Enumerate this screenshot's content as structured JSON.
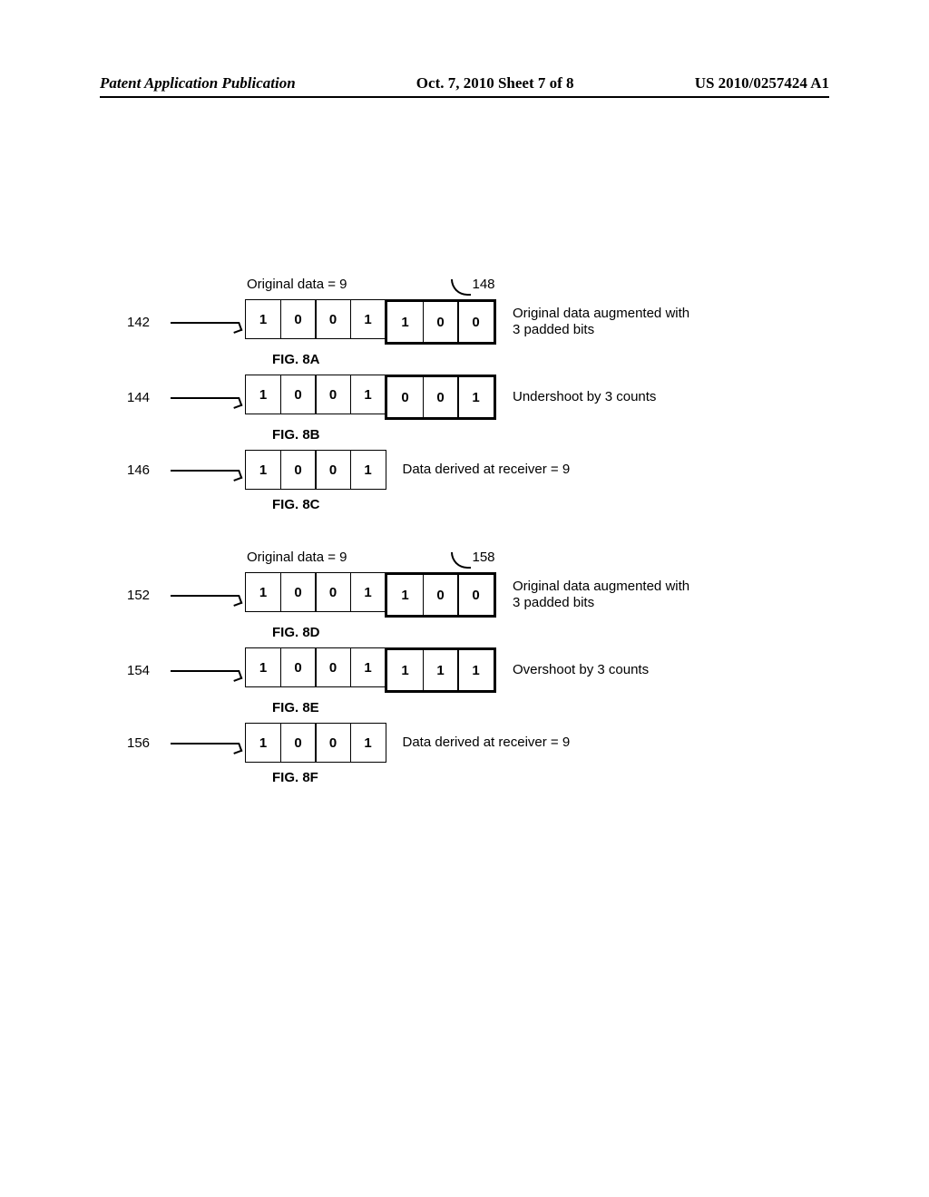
{
  "header": {
    "left": "Patent Application Publication",
    "center": "Oct. 7, 2010   Sheet 7 of 8",
    "right": "US 2010/0257424 A1"
  },
  "group1": {
    "top_label": "Original data = 9",
    "callout_ref": "148",
    "fig_a": {
      "ref": "142",
      "bits_main": [
        "1",
        "0",
        "0",
        "1"
      ],
      "bits_pad": [
        "1",
        "0",
        "0"
      ],
      "desc": "Original data augmented with 3 padded bits",
      "label": "FIG. 8A"
    },
    "fig_b": {
      "ref": "144",
      "bits_main": [
        "1",
        "0",
        "0",
        "1"
      ],
      "bits_pad": [
        "0",
        "0",
        "1"
      ],
      "desc": "Undershoot by 3 counts",
      "label": "FIG. 8B"
    },
    "fig_c": {
      "ref": "146",
      "bits_main": [
        "1",
        "0",
        "0",
        "1"
      ],
      "desc": "Data derived at receiver = 9",
      "label": "FIG. 8C"
    }
  },
  "group2": {
    "top_label": "Original data = 9",
    "callout_ref": "158",
    "fig_d": {
      "ref": "152",
      "bits_main": [
        "1",
        "0",
        "0",
        "1"
      ],
      "bits_pad": [
        "1",
        "0",
        "0"
      ],
      "desc": "Original data augmented with 3 padded bits",
      "label": "FIG. 8D"
    },
    "fig_e": {
      "ref": "154",
      "bits_main": [
        "1",
        "0",
        "0",
        "1"
      ],
      "bits_pad": [
        "1",
        "1",
        "1"
      ],
      "desc": "Overshoot by 3 counts",
      "label": "FIG. 8E"
    },
    "fig_f": {
      "ref": "156",
      "bits_main": [
        "1",
        "0",
        "0",
        "1"
      ],
      "desc": "Data derived at receiver = 9",
      "label": "FIG. 8F"
    }
  }
}
